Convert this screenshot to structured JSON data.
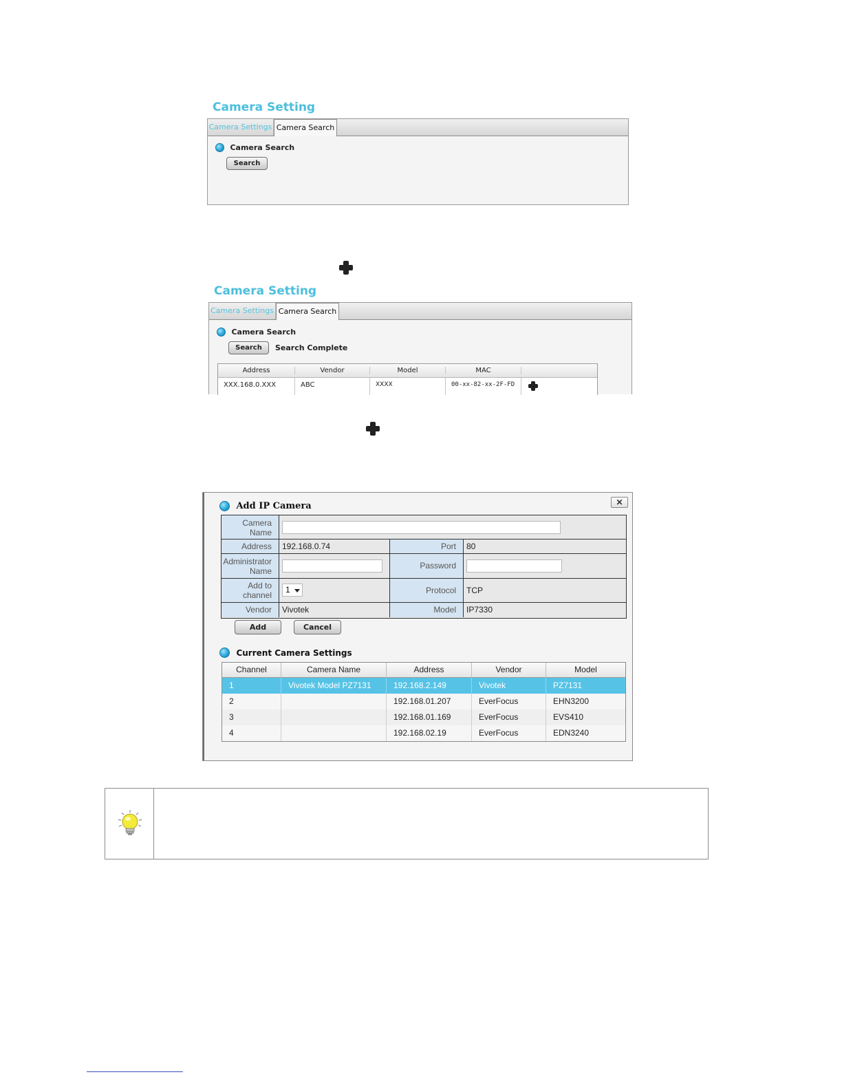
{
  "panel1": {
    "title": "Camera Setting",
    "tabs": [
      {
        "label": "Camera Settings"
      },
      {
        "label": "Camera Search"
      }
    ],
    "section_label": "Camera Search",
    "search_button": "Search"
  },
  "panel2": {
    "title": "Camera Setting",
    "tabs": [
      {
        "label": "Camera Settings"
      },
      {
        "label": "Camera Search"
      }
    ],
    "section_label": "Camera Search",
    "search_button": "Search",
    "status": "Search Complete",
    "columns": [
      "Address",
      "Vendor",
      "Model",
      "MAC"
    ],
    "row": {
      "address": "XXX.168.0.XXX",
      "vendor": "ABC",
      "model": "XXXX",
      "mac": "00-xx-82-xx-2F-FD"
    }
  },
  "dialog": {
    "title": "Add IP Camera",
    "close_icon": "close-icon",
    "form": {
      "camera_name_label": "Camera Name",
      "camera_name_value": "",
      "address_label": "Address",
      "address_value": "192.168.0.74",
      "port_label": "Port",
      "port_value": "80",
      "admin_label": "Administrator Name",
      "admin_value": "",
      "password_label": "Password",
      "password_value": "",
      "channel_label": "Add to channel",
      "channel_value": "1",
      "protocol_label": "Protocol",
      "protocol_value": "TCP",
      "vendor_label": "Vendor",
      "vendor_value": "Vivotek",
      "model_label": "Model",
      "model_value": "IP7330"
    },
    "add_button": "Add",
    "cancel_button": "Cancel",
    "current_title": "Current Camera Settings",
    "columns": [
      "Channel",
      "Camera Name",
      "Address",
      "Vendor",
      "Model"
    ],
    "rows": [
      {
        "channel": "1",
        "name": "Vivotek Model PZ7131",
        "address": "192.168.2.149",
        "vendor": "Vivotek",
        "model": "PZ7131",
        "selected": true
      },
      {
        "channel": "2",
        "name": "",
        "address": "192.168.01.207",
        "vendor": "EverFocus",
        "model": "EHN3200",
        "selected": false
      },
      {
        "channel": "3",
        "name": "",
        "address": "192.168.01.169",
        "vendor": "EverFocus",
        "model": "EVS410",
        "selected": false
      },
      {
        "channel": "4",
        "name": "",
        "address": "192.168.02.19",
        "vendor": "EverFocus",
        "model": "EDN3240",
        "selected": false
      }
    ],
    "selected_color": "#56c3e6"
  },
  "icons": {
    "plus": "plus-icon",
    "lightbulb": "lightbulb-icon"
  }
}
